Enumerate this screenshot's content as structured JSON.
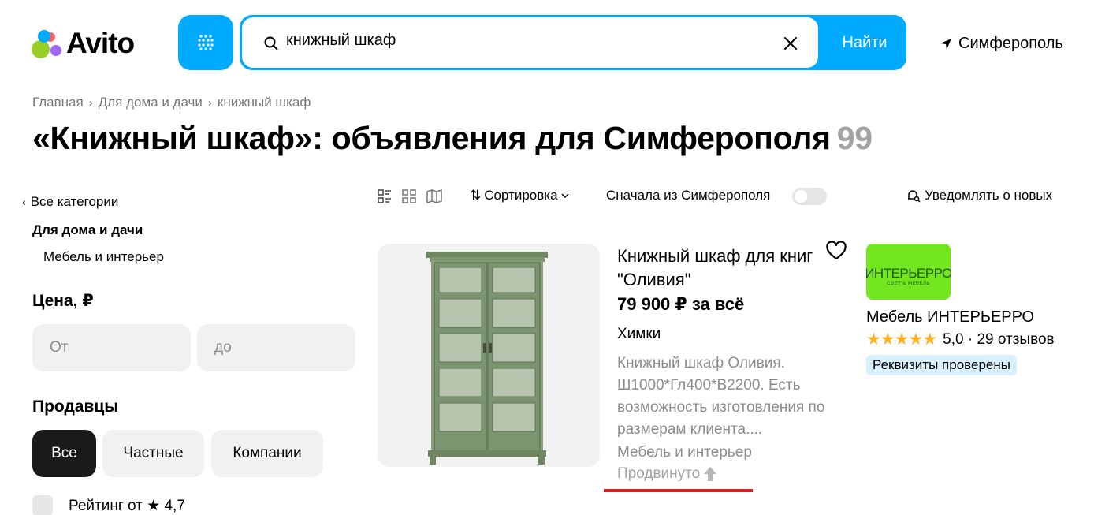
{
  "header": {
    "logo_text": "Avito",
    "logo_colors": [
      "#97cf26",
      "#a169f7",
      "#ff6163",
      "#00aaff"
    ],
    "search_value": "книжный шкаф",
    "search_button": "Найти",
    "city": "Симферополь",
    "accent_color": "#00aaff"
  },
  "breadcrumbs": [
    "Главная",
    "Для дома и дачи",
    "книжный шкаф"
  ],
  "title": {
    "text": "«Книжный шкаф»: объявления для Симферополя",
    "count": "99"
  },
  "sidebar": {
    "all_categories": "Все категории",
    "category": "Для дома и дачи",
    "subcategory": "Мебель и интерьер",
    "price_label": "Цена, ₽",
    "price_from_placeholder": "От",
    "price_to_placeholder": "до",
    "sellers_label": "Продавцы",
    "sellers_options": [
      "Все",
      "Частные",
      "Компании"
    ],
    "sellers_selected": "Все",
    "rating_label": "Рейтинг от ★ 4,7"
  },
  "toolbar": {
    "view_icons": [
      "list-view-icon",
      "grid-view-icon",
      "map-view-icon"
    ],
    "sort_label": "Сортировка",
    "from_city_label": "Сначала из Симферополя",
    "from_city_enabled": false,
    "notify_label": "Уведомлять о новых"
  },
  "listing": {
    "title": "Книжный шкаф для книг \"Оливия\"",
    "price": "79 900 ₽ за всё",
    "location": "Химки",
    "description": "Книжный шкаф Оливия. Ш1000*Гл400*В2200. Есть возможность изготовления по размерам клиента....",
    "category": "Мебель и интерьер",
    "promoted": "Продвинуто",
    "favorite": false
  },
  "seller": {
    "logo_text": "ИНТЕРЬЕРРО",
    "logo_subtext": "СВЕТ & МЕБЕЛЬ",
    "name": "Мебель ИНТЕРЬЕРРО",
    "stars": "★★★★★",
    "rating": "5,0 · 29 отзывов",
    "verified": "Реквизиты проверены"
  }
}
